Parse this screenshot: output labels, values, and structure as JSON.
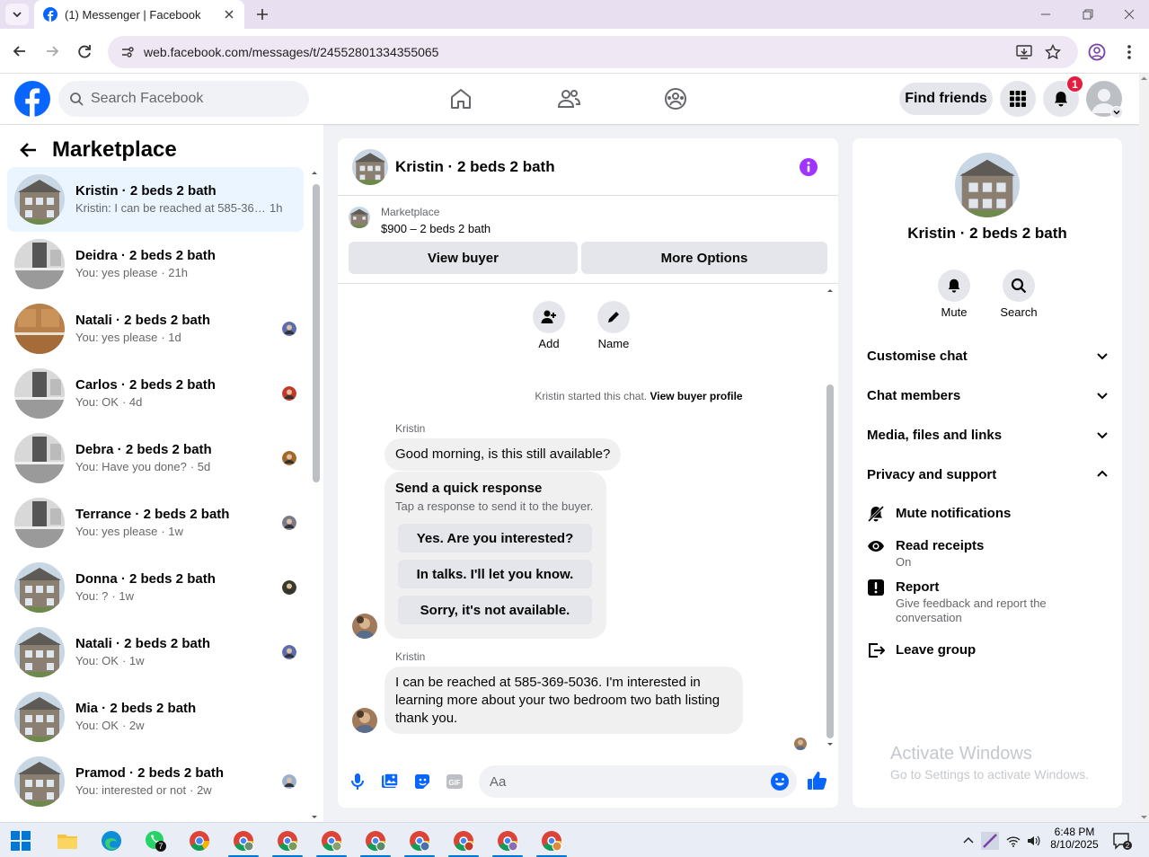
{
  "browser": {
    "tab_title": "(1) Messenger | Facebook",
    "url": "web.facebook.com/messages/t/24552801334355065"
  },
  "fb_header": {
    "search_placeholder": "Search Facebook",
    "find_friends": "Find friends",
    "notification_count": "1"
  },
  "sidebar": {
    "title": "Marketplace",
    "conversations": [
      {
        "name": "Kristin · 2 beds 2 bath",
        "snippet": "Kristin: I can be reached at 585-369...",
        "time": "1h",
        "active": true
      },
      {
        "name": "Deidra · 2 beds 2 bath",
        "snippet": "You: yes please",
        "time": "21h"
      },
      {
        "name": "Natali · 2 beds 2 bath",
        "snippet": "You: yes please",
        "time": "1d"
      },
      {
        "name": "Carlos · 2 beds 2 bath",
        "snippet": "You: OK",
        "time": "4d"
      },
      {
        "name": "Debra · 2 beds 2 bath",
        "snippet": "You: Have you done?",
        "time": "5d"
      },
      {
        "name": "Terrance · 2 beds 2 bath",
        "snippet": "You: yes please",
        "time": "1w"
      },
      {
        "name": "Donna · 2 beds 2 bath",
        "snippet": "You: ?",
        "time": "1w"
      },
      {
        "name": "Natali · 2 beds 2 bath",
        "snippet": "You: OK",
        "time": "1w"
      },
      {
        "name": "Mia · 2 beds 2 bath",
        "snippet": "You: OK",
        "time": "2w"
      },
      {
        "name": "Pramod · 2 beds 2 bath",
        "snippet": "You: interested or not",
        "time": "2w"
      }
    ]
  },
  "chat": {
    "title": "Kristin · 2 beds 2 bath",
    "listing_source": "Marketplace",
    "listing_price": "$900 – 2 beds 2 bath",
    "view_buyer": "View buyer",
    "more_options": "More Options",
    "add_label": "Add",
    "name_label": "Name",
    "started_text": "Kristin started this chat.",
    "view_buyer_profile": "View buyer profile",
    "sender": "Kristin",
    "message_1": "Good morning, is this still available?",
    "quick_response_title": "Send a quick response",
    "quick_response_sub": "Tap a response to send it to the buyer.",
    "quick_responses": [
      "Yes. Are you interested?",
      "In talks. I'll let you know.",
      "Sorry, it's not available."
    ],
    "message_2_lines": [
      "I can be reached at 585-369-5036. I'm interested in",
      "learning more about your two bedroom two bath listing",
      "thank you."
    ],
    "composer_placeholder": "Aa"
  },
  "right_panel": {
    "name": "Kristin · 2 beds 2 bath",
    "mute": "Mute",
    "search": "Search",
    "sections": [
      "Customise chat",
      "Chat members",
      "Media, files and links",
      "Privacy and support"
    ],
    "privacy": {
      "mute_notifications": "Mute notifications",
      "read_receipts": "Read receipts",
      "read_receipts_state": "On",
      "report": "Report",
      "report_desc_1": "Give feedback and report the",
      "report_desc_2": "conversation",
      "leave_group": "Leave group"
    }
  },
  "watermark": {
    "line1": "Activate Windows",
    "line2": "Go to Settings to activate Windows."
  },
  "taskbar": {
    "time": "6:48 PM",
    "date": "8/10/2025",
    "whatsapp_badge": "7",
    "notification_badge": "2"
  },
  "colors": {
    "fb_blue": "#0866ff",
    "messenger_purple": "#a033ff",
    "active_bg": "#ebf5ff"
  }
}
